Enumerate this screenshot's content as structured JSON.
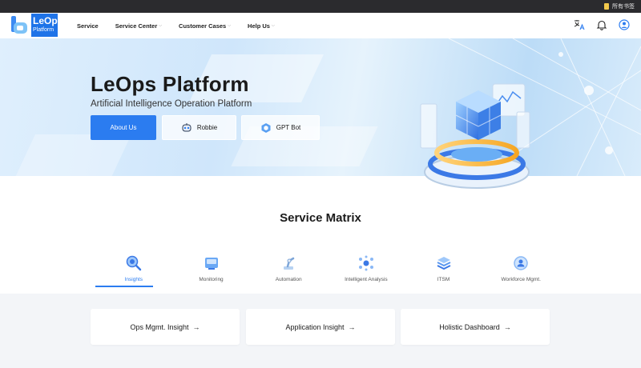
{
  "bookmarks": {
    "all_bookmarks": "所有书签"
  },
  "brand": {
    "name_line1": "LeOps",
    "name_line2": "Platform"
  },
  "nav": {
    "items": [
      {
        "label": "Service",
        "has_dropdown": false
      },
      {
        "label": "Service Center",
        "has_dropdown": true
      },
      {
        "label": "Customer Cases",
        "has_dropdown": true
      },
      {
        "label": "Help Us",
        "has_dropdown": true
      }
    ],
    "dropdown_glyph": "⌵",
    "icons": [
      "translate-icon",
      "bell-icon",
      "user-icon"
    ]
  },
  "hero": {
    "title": "LeOps Platform",
    "subtitle": "Artificial Intelligence Operation Platform",
    "buttons": {
      "about": "About Us",
      "robbie": "Robbie",
      "gpt": "GPT Bot"
    }
  },
  "matrix": {
    "title": "Service Matrix",
    "tabs": [
      {
        "label": "Insights",
        "icon": "insights-icon",
        "active": true
      },
      {
        "label": "Monitoring",
        "icon": "monitoring-icon",
        "active": false
      },
      {
        "label": "Automation",
        "icon": "automation-icon",
        "active": false
      },
      {
        "label": "Intelligent Analysis",
        "icon": "analysis-icon",
        "active": false
      },
      {
        "label": "ITSM",
        "icon": "itsm-icon",
        "active": false
      },
      {
        "label": "Workforce Mgmt.",
        "icon": "workforce-icon",
        "active": false
      }
    ]
  },
  "cards": [
    {
      "label": "Ops Mgmt. Insight",
      "arrow": "→"
    },
    {
      "label": "Application Insight",
      "arrow": "→"
    },
    {
      "label": "Holistic Dashboard",
      "arrow": "→"
    }
  ],
  "colors": {
    "primary": "#2b7cf0",
    "brand_blue": "#1e73e8",
    "bookmark_bar": "#2b2b2e",
    "card_bg": "#f3f5f8"
  }
}
